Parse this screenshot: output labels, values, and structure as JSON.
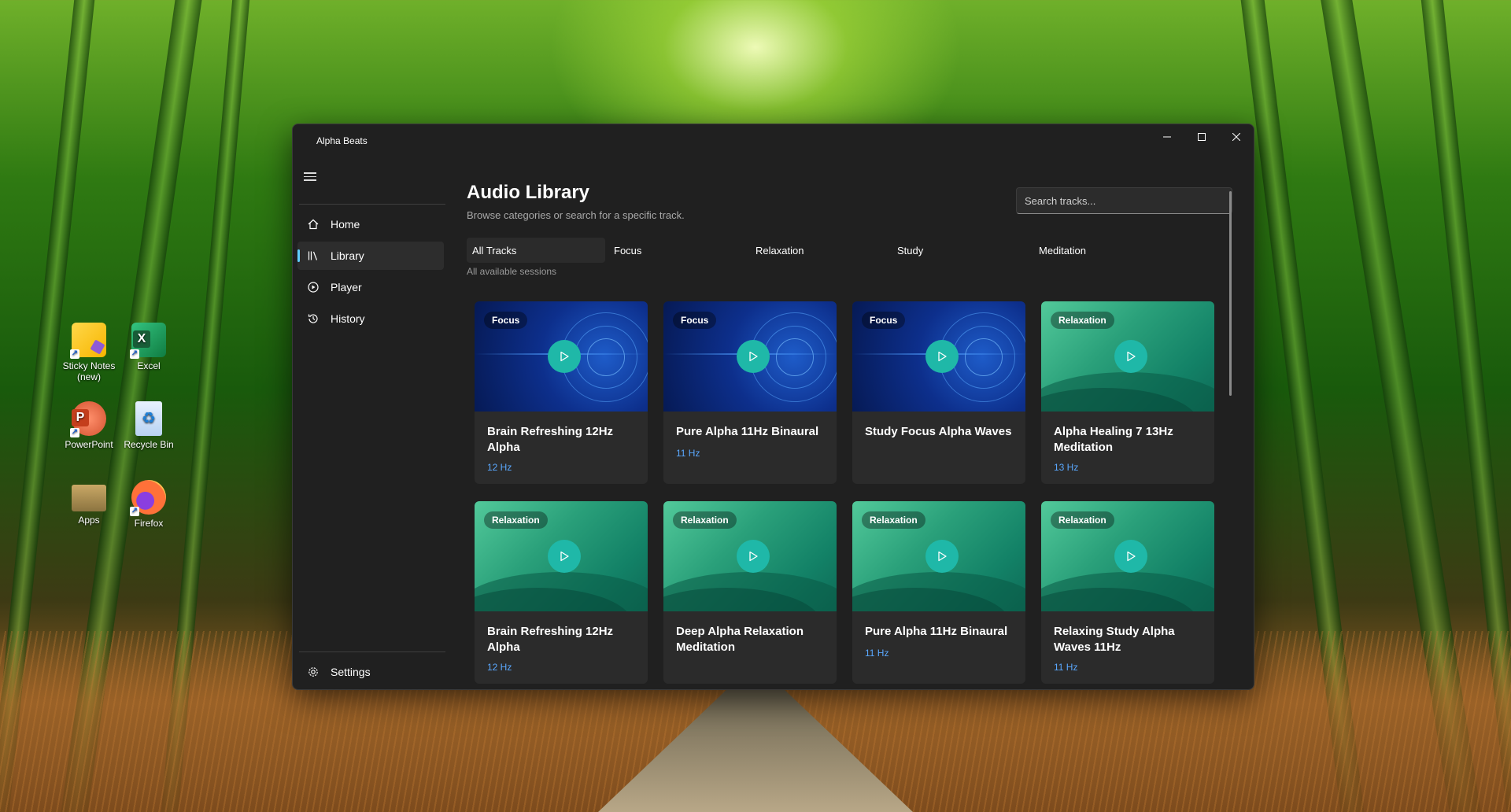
{
  "desktop": {
    "icons": [
      {
        "label": "Sticky Notes (new)",
        "icon": "sticky-notes-icon"
      },
      {
        "label": "Excel",
        "icon": "excel-icon"
      },
      {
        "label": "PowerPoint",
        "icon": "powerpoint-icon"
      },
      {
        "label": "Recycle Bin",
        "icon": "recycle-bin-icon"
      },
      {
        "label": "Apps",
        "icon": "folder-icon"
      },
      {
        "label": "Firefox",
        "icon": "firefox-icon"
      }
    ]
  },
  "window": {
    "title": "Alpha Beats",
    "controls": {
      "minimize": "minimize-icon",
      "maximize": "maximize-icon",
      "close": "close-icon"
    }
  },
  "sidebar": {
    "items": [
      {
        "label": "Home",
        "icon": "home-icon"
      },
      {
        "label": "Library",
        "icon": "library-icon",
        "active": true
      },
      {
        "label": "Player",
        "icon": "play-circle-icon"
      },
      {
        "label": "History",
        "icon": "history-icon"
      }
    ],
    "footer": {
      "label": "Settings",
      "icon": "gear-icon"
    }
  },
  "main": {
    "title": "Audio Library",
    "subtitle": "Browse categories or search for a specific track.",
    "search": {
      "placeholder": "Search tracks...",
      "value": ""
    },
    "tabs": [
      {
        "label": "All Tracks",
        "active": true
      },
      {
        "label": "Focus"
      },
      {
        "label": "Relaxation"
      },
      {
        "label": "Study"
      },
      {
        "label": "Meditation"
      }
    ],
    "tab_description": "All available sessions",
    "tracks": [
      {
        "category": "Focus",
        "name": "Brain Refreshing 12Hz Alpha",
        "hz": "12 Hz"
      },
      {
        "category": "Focus",
        "name": "Pure Alpha 11Hz Binaural",
        "hz": "11 Hz"
      },
      {
        "category": "Focus",
        "name": "Study Focus Alpha Waves",
        "hz": ""
      },
      {
        "category": "Relaxation",
        "name": "Alpha Healing 7 13Hz Meditation",
        "hz": "13 Hz"
      },
      {
        "category": "Relaxation",
        "name": "Brain Refreshing 12Hz Alpha",
        "hz": "12 Hz"
      },
      {
        "category": "Relaxation",
        "name": "Deep Alpha Relaxation Meditation",
        "hz": ""
      },
      {
        "category": "Relaxation",
        "name": "Pure Alpha 11Hz Binaural",
        "hz": "11 Hz"
      },
      {
        "category": "Relaxation",
        "name": "Relaxing Study Alpha Waves 11Hz",
        "hz": "11 Hz"
      }
    ]
  },
  "colors": {
    "accent": "#60cdff",
    "hz_text": "#5aa8ff",
    "play_button": "#1fb8a8",
    "window_bg": "#202020",
    "card_bg": "#2b2b2b"
  }
}
